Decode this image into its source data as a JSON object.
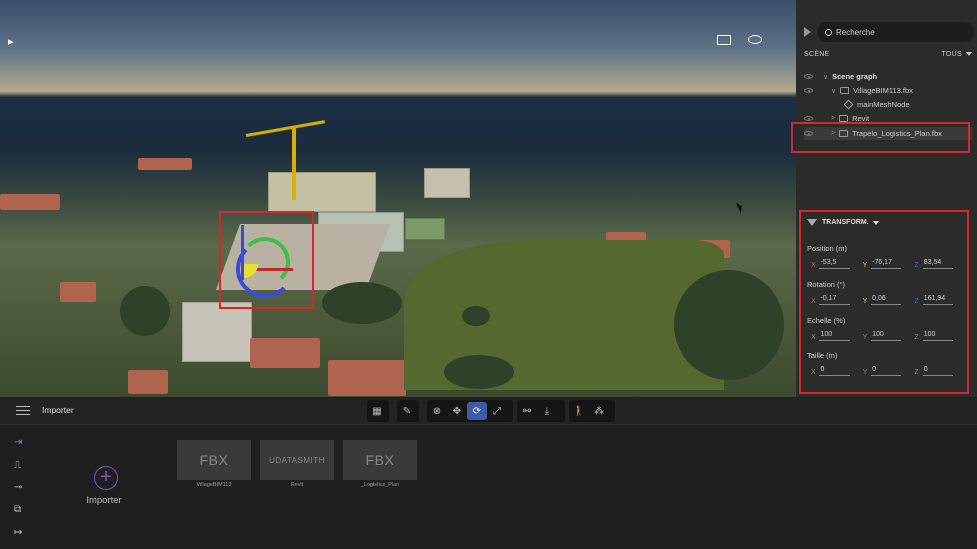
{
  "scene_panel": {
    "search_placeholder": "Recherche",
    "section_title": "SCÈNE",
    "filter_label": "TOUS",
    "tree": [
      {
        "label": "Scene graph",
        "level": 0
      },
      {
        "label": "VillageBIM113.fbx",
        "level": 1
      },
      {
        "label": "mainMeshNode",
        "level": 2
      },
      {
        "label": "Revit",
        "level": 1
      },
      {
        "label": "Trapelo_Logistics_Plan.fbx",
        "level": 1,
        "highlighted": true
      }
    ]
  },
  "transform": {
    "title": "TRANSFORM.",
    "position_label": "Position (m)",
    "position": {
      "x": "-53,5",
      "y": "-76,17",
      "z": "83,54"
    },
    "rotation_label": "Rotation (°)",
    "rotation": {
      "x": "-0,17",
      "y": "0,06",
      "z": "161,94"
    },
    "scale_label": "Echelle (%)",
    "scale": {
      "x": "100",
      "y": "100",
      "z": "100"
    },
    "size_label": "Taille (m)",
    "size": {
      "x": "0",
      "y": "0",
      "z": "0"
    },
    "axis_labels": {
      "x": "X",
      "y": "Y",
      "z": "Z"
    }
  },
  "bottom_bar": {
    "title": "Importer"
  },
  "importer": {
    "add_label": "Importer",
    "files": [
      {
        "type": "FBX",
        "name": "VillageBIM113"
      },
      {
        "type": "UDATASMITH",
        "name": "Revit"
      },
      {
        "type": "FBX",
        "name": "_Logistics_Plan"
      }
    ]
  },
  "colors": {
    "accent_purple": "#9a6cd8",
    "highlight_red": "#d8262b",
    "active_tool_blue": "#3c5ba8"
  }
}
